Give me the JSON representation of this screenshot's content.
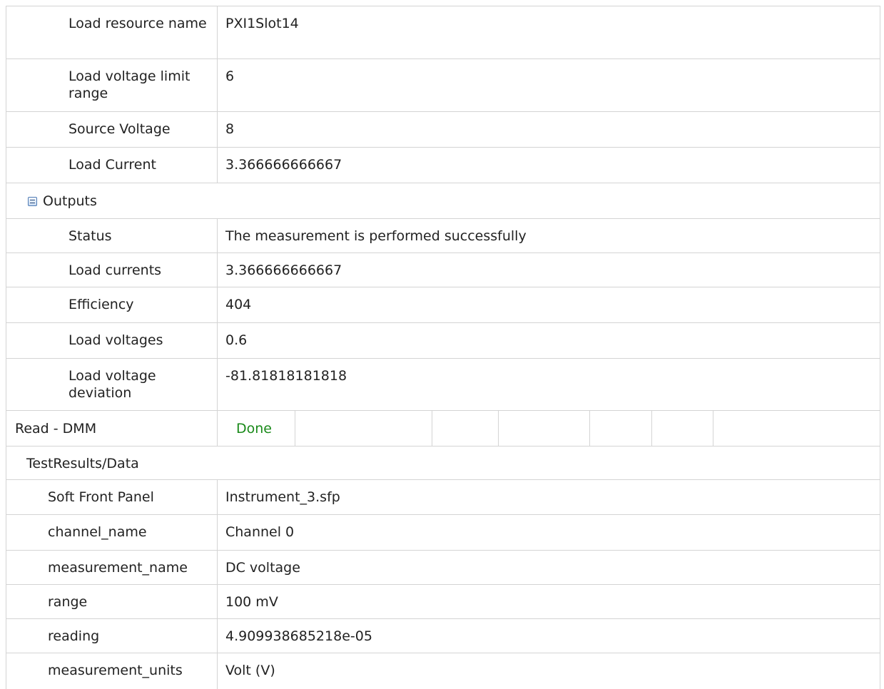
{
  "inputs_rows": [
    {
      "label": "Load resource name",
      "value": "PXI1Slot14"
    },
    {
      "label": "Load voltage limit range",
      "value": "6"
    },
    {
      "label": "Source Voltage",
      "value": "8"
    },
    {
      "label": "Load Current",
      "value": "3.366666666667"
    }
  ],
  "outputs": {
    "title": "Outputs",
    "rows": [
      {
        "label": "Status",
        "value": "The measurement is performed successfully"
      },
      {
        "label": "Load currents",
        "value": "3.366666666667"
      },
      {
        "label": "Efficiency",
        "value": "404"
      },
      {
        "label": "Load voltages",
        "value": "0.6"
      },
      {
        "label": "Load voltage deviation",
        "value": "-81.81818181818"
      }
    ]
  },
  "step": {
    "name": "Read - DMM",
    "status": "Done",
    "status_color": "#1a8a1a"
  },
  "test_results": {
    "title": "TestResults/Data",
    "rows": [
      {
        "label": "Soft Front Panel",
        "value": "Instrument_3.sfp"
      },
      {
        "label": "channel_name",
        "value": "Channel 0"
      },
      {
        "label": "measurement_name",
        "value": "DC voltage"
      },
      {
        "label": "range",
        "value": "100 mV"
      },
      {
        "label": "reading",
        "value": "4.909938685218e-05"
      },
      {
        "label": "measurement_units",
        "value": "Volt (V)"
      }
    ]
  }
}
